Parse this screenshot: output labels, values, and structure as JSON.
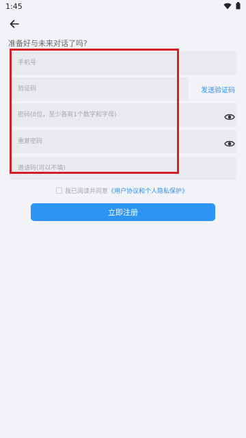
{
  "status_bar": {
    "time": "1:45",
    "icons": [
      "wifi-icon",
      "battery-icon"
    ]
  },
  "header": {
    "back_icon": "arrow-left-icon"
  },
  "form": {
    "title": "准备好与未来对话了吗?",
    "phone_placeholder": "手机号",
    "code_placeholder": "验证码",
    "send_code_label": "发送验证码",
    "password_placeholder": "密码(8位，至少各有1个数字和字母)",
    "repeat_password_placeholder": "重复密码",
    "invite_placeholder": "邀请码(可以不填)",
    "eye_icon": "eye-icon"
  },
  "agreement": {
    "prefix": "我已阅读并同意",
    "link": "《用户协议和个人隐私保护》",
    "checked": false
  },
  "actions": {
    "register_label": "立即注册"
  },
  "colors": {
    "accent": "#2d95f3",
    "link": "#2d8ff0",
    "highlight": "#d21e27",
    "background": "#f2f3f6",
    "field": "#e9eaee"
  }
}
